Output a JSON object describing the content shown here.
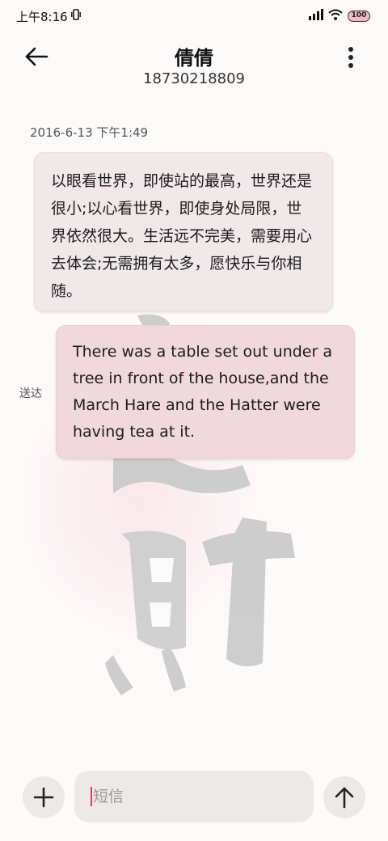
{
  "status_bar": {
    "time": "上午8:16",
    "battery": "100",
    "icons": [
      "vibrate-icon",
      "signal-icon",
      "wifi-icon",
      "battery-icon"
    ]
  },
  "header": {
    "contact_name": "倩倩",
    "contact_number": "18730218809",
    "back_icon": "arrow-left-icon",
    "more_icon": "more-vertical-icon"
  },
  "conversation": {
    "timestamp": "2016-6-13 下午1:49",
    "messages": [
      {
        "direction": "received",
        "text": "以眼看世界，即使站的最高，世界还是很小;以心看世界，即使身处局限，世界依然很大。生活远不完美，需要用心去体会;无需拥有太多，愿快乐与你相随。"
      },
      {
        "direction": "sent",
        "text": "There was a table set out under a tree in front of the house,and the March Hare and the Hatter were having tea at it.",
        "status": "送达"
      }
    ]
  },
  "composer": {
    "placeholder": "短信",
    "value": "",
    "add_icon": "plus-icon",
    "send_icon": "arrow-up-icon"
  },
  "colors": {
    "received_bubble": "#f1e9e9",
    "sent_bubble": "#f0d9dd",
    "caret": "#e03a5a"
  }
}
